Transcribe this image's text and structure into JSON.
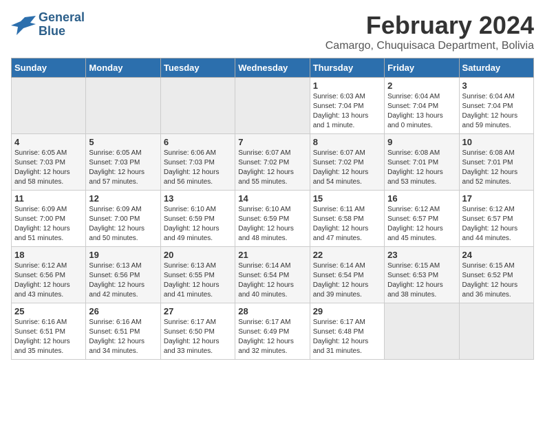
{
  "header": {
    "logo_line1": "General",
    "logo_line2": "Blue",
    "month_title": "February 2024",
    "subtitle": "Camargo, Chuquisaca Department, Bolivia"
  },
  "days_of_week": [
    "Sunday",
    "Monday",
    "Tuesday",
    "Wednesday",
    "Thursday",
    "Friday",
    "Saturday"
  ],
  "weeks": [
    [
      {
        "day": "",
        "info": ""
      },
      {
        "day": "",
        "info": ""
      },
      {
        "day": "",
        "info": ""
      },
      {
        "day": "",
        "info": ""
      },
      {
        "day": "1",
        "info": "Sunrise: 6:03 AM\nSunset: 7:04 PM\nDaylight: 13 hours\nand 1 minute."
      },
      {
        "day": "2",
        "info": "Sunrise: 6:04 AM\nSunset: 7:04 PM\nDaylight: 13 hours\nand 0 minutes."
      },
      {
        "day": "3",
        "info": "Sunrise: 6:04 AM\nSunset: 7:04 PM\nDaylight: 12 hours\nand 59 minutes."
      }
    ],
    [
      {
        "day": "4",
        "info": "Sunrise: 6:05 AM\nSunset: 7:03 PM\nDaylight: 12 hours\nand 58 minutes."
      },
      {
        "day": "5",
        "info": "Sunrise: 6:05 AM\nSunset: 7:03 PM\nDaylight: 12 hours\nand 57 minutes."
      },
      {
        "day": "6",
        "info": "Sunrise: 6:06 AM\nSunset: 7:03 PM\nDaylight: 12 hours\nand 56 minutes."
      },
      {
        "day": "7",
        "info": "Sunrise: 6:07 AM\nSunset: 7:02 PM\nDaylight: 12 hours\nand 55 minutes."
      },
      {
        "day": "8",
        "info": "Sunrise: 6:07 AM\nSunset: 7:02 PM\nDaylight: 12 hours\nand 54 minutes."
      },
      {
        "day": "9",
        "info": "Sunrise: 6:08 AM\nSunset: 7:01 PM\nDaylight: 12 hours\nand 53 minutes."
      },
      {
        "day": "10",
        "info": "Sunrise: 6:08 AM\nSunset: 7:01 PM\nDaylight: 12 hours\nand 52 minutes."
      }
    ],
    [
      {
        "day": "11",
        "info": "Sunrise: 6:09 AM\nSunset: 7:00 PM\nDaylight: 12 hours\nand 51 minutes."
      },
      {
        "day": "12",
        "info": "Sunrise: 6:09 AM\nSunset: 7:00 PM\nDaylight: 12 hours\nand 50 minutes."
      },
      {
        "day": "13",
        "info": "Sunrise: 6:10 AM\nSunset: 6:59 PM\nDaylight: 12 hours\nand 49 minutes."
      },
      {
        "day": "14",
        "info": "Sunrise: 6:10 AM\nSunset: 6:59 PM\nDaylight: 12 hours\nand 48 minutes."
      },
      {
        "day": "15",
        "info": "Sunrise: 6:11 AM\nSunset: 6:58 PM\nDaylight: 12 hours\nand 47 minutes."
      },
      {
        "day": "16",
        "info": "Sunrise: 6:12 AM\nSunset: 6:57 PM\nDaylight: 12 hours\nand 45 minutes."
      },
      {
        "day": "17",
        "info": "Sunrise: 6:12 AM\nSunset: 6:57 PM\nDaylight: 12 hours\nand 44 minutes."
      }
    ],
    [
      {
        "day": "18",
        "info": "Sunrise: 6:12 AM\nSunset: 6:56 PM\nDaylight: 12 hours\nand 43 minutes."
      },
      {
        "day": "19",
        "info": "Sunrise: 6:13 AM\nSunset: 6:56 PM\nDaylight: 12 hours\nand 42 minutes."
      },
      {
        "day": "20",
        "info": "Sunrise: 6:13 AM\nSunset: 6:55 PM\nDaylight: 12 hours\nand 41 minutes."
      },
      {
        "day": "21",
        "info": "Sunrise: 6:14 AM\nSunset: 6:54 PM\nDaylight: 12 hours\nand 40 minutes."
      },
      {
        "day": "22",
        "info": "Sunrise: 6:14 AM\nSunset: 6:54 PM\nDaylight: 12 hours\nand 39 minutes."
      },
      {
        "day": "23",
        "info": "Sunrise: 6:15 AM\nSunset: 6:53 PM\nDaylight: 12 hours\nand 38 minutes."
      },
      {
        "day": "24",
        "info": "Sunrise: 6:15 AM\nSunset: 6:52 PM\nDaylight: 12 hours\nand 36 minutes."
      }
    ],
    [
      {
        "day": "25",
        "info": "Sunrise: 6:16 AM\nSunset: 6:51 PM\nDaylight: 12 hours\nand 35 minutes."
      },
      {
        "day": "26",
        "info": "Sunrise: 6:16 AM\nSunset: 6:51 PM\nDaylight: 12 hours\nand 34 minutes."
      },
      {
        "day": "27",
        "info": "Sunrise: 6:17 AM\nSunset: 6:50 PM\nDaylight: 12 hours\nand 33 minutes."
      },
      {
        "day": "28",
        "info": "Sunrise: 6:17 AM\nSunset: 6:49 PM\nDaylight: 12 hours\nand 32 minutes."
      },
      {
        "day": "29",
        "info": "Sunrise: 6:17 AM\nSunset: 6:48 PM\nDaylight: 12 hours\nand 31 minutes."
      },
      {
        "day": "",
        "info": ""
      },
      {
        "day": "",
        "info": ""
      }
    ]
  ]
}
